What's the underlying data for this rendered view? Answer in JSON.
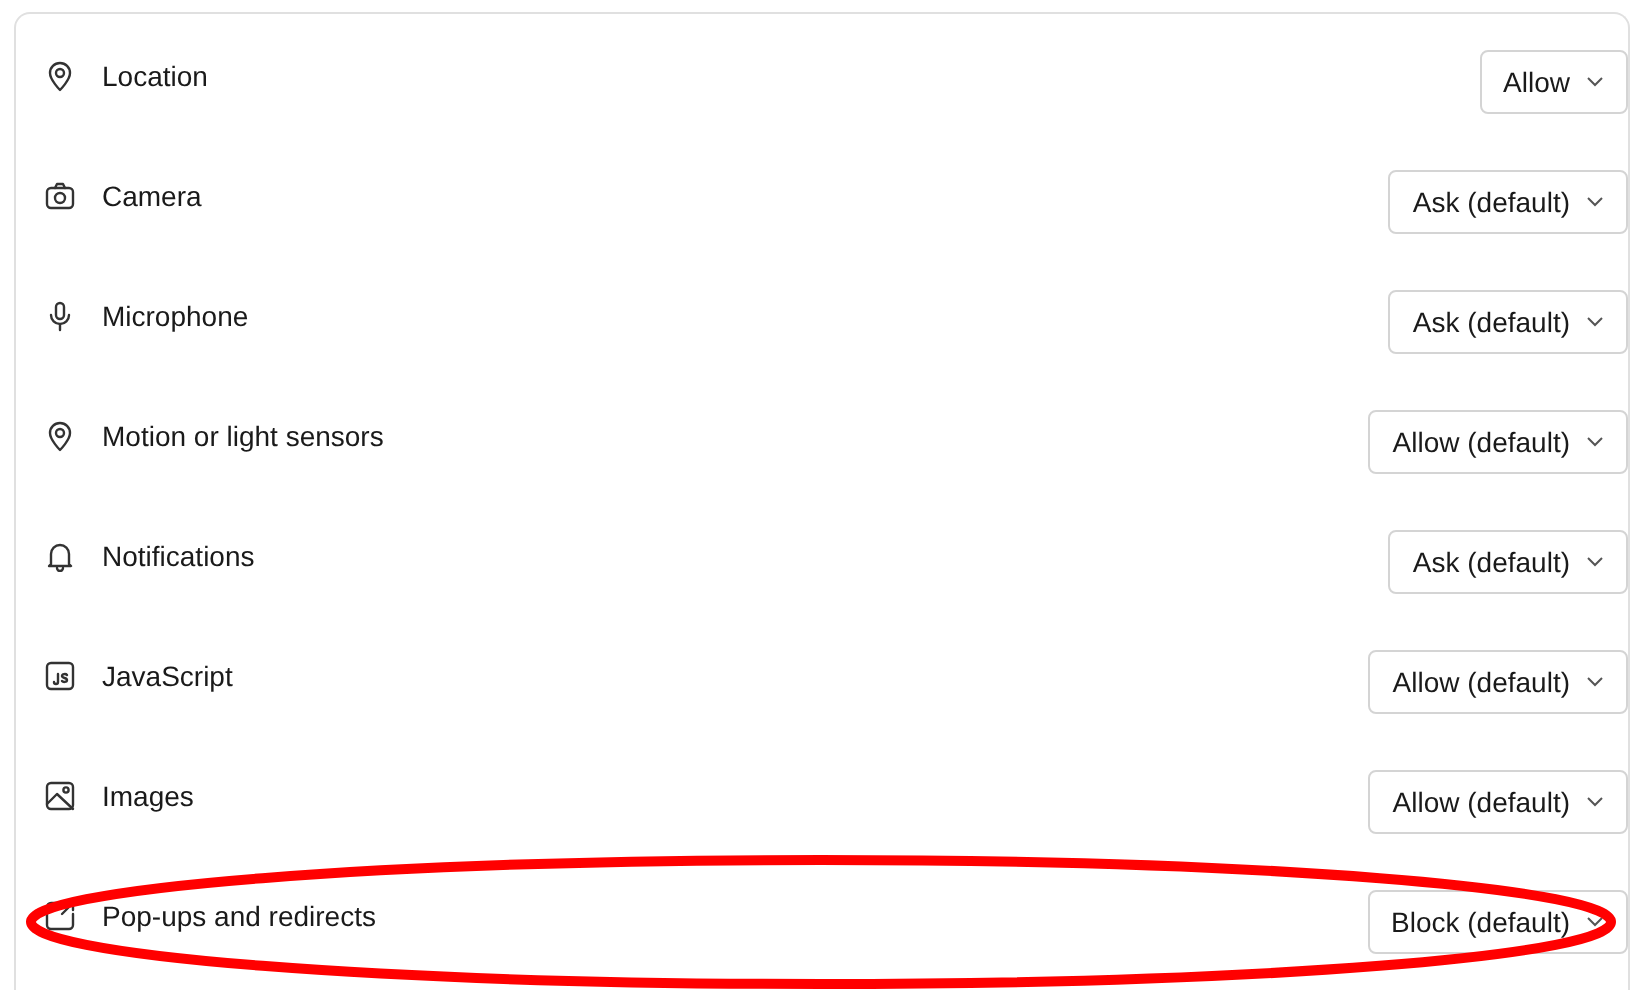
{
  "permissions": [
    {
      "label": "Location",
      "value": "Allow",
      "highlighted": false
    },
    {
      "label": "Camera",
      "value": "Ask (default)",
      "highlighted": false
    },
    {
      "label": "Microphone",
      "value": "Ask (default)",
      "highlighted": false
    },
    {
      "label": "Motion or light sensors",
      "value": "Allow (default)",
      "highlighted": false
    },
    {
      "label": "Notifications",
      "value": "Ask (default)",
      "highlighted": false
    },
    {
      "label": "JavaScript",
      "value": "Allow (default)",
      "highlighted": false
    },
    {
      "label": "Images",
      "value": "Allow (default)",
      "highlighted": false
    },
    {
      "label": "Pop-ups and redirects",
      "value": "Block (default)",
      "highlighted": true
    }
  ]
}
